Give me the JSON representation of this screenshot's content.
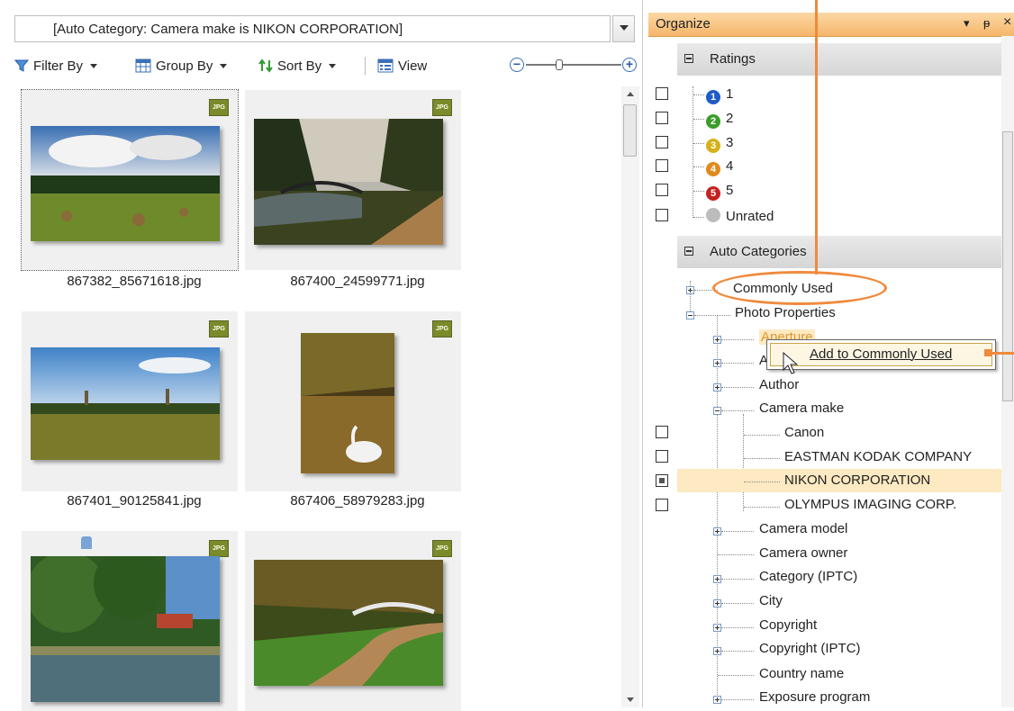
{
  "filter": {
    "text": "[Auto Category: Camera make is NIKON CORPORATION]"
  },
  "toolbar": {
    "filter_label": "Filter By",
    "group_label": "Group By",
    "sort_label": "Sort By",
    "view_label": "View",
    "zoom_minus": "−",
    "zoom_plus": "+",
    "zoom_level": 0
  },
  "thumbnails": [
    {
      "file": "867382_85671618.jpg",
      "badge": "JPG",
      "selected": true
    },
    {
      "file": "867400_24599771.jpg",
      "badge": "JPG"
    },
    {
      "file": "867401_90125841.jpg",
      "badge": "JPG"
    },
    {
      "file": "867406_58979283.jpg",
      "badge": "JPG"
    },
    {
      "file": "",
      "badge": "JPG"
    },
    {
      "file": "",
      "badge": "JPG"
    }
  ],
  "organize": {
    "title": "Organize",
    "controls": {
      "menu": "▾",
      "pin": "ᵽ",
      "close": "×"
    }
  },
  "ratings": {
    "title": "Ratings",
    "items": [
      {
        "label": "1",
        "color": "#1e5bc6"
      },
      {
        "label": "2",
        "color": "#3a9d2a"
      },
      {
        "label": "3",
        "color": "#d6b21a"
      },
      {
        "label": "4",
        "color": "#e08a1e"
      },
      {
        "label": "5",
        "color": "#c4221f"
      },
      {
        "label": "Unrated",
        "color": "#bcbcbc"
      }
    ]
  },
  "auto_categories": {
    "title": "Auto Categories",
    "commonly_used": "Commonly Used",
    "photo_properties": "Photo Properties",
    "aperture": "Aperture",
    "a_item": "A",
    "author": "Author",
    "camera_make": "Camera make",
    "makes": [
      "Canon",
      "EASTMAN KODAK COMPANY",
      "NIKON CORPORATION",
      "OLYMPUS IMAGING CORP."
    ],
    "after": [
      "Camera model",
      "Camera owner",
      "Category (IPTC)",
      "City",
      "Copyright",
      "Copyright (IPTC)",
      "Country name",
      "Exposure program"
    ]
  },
  "context_menu": {
    "label": "Add to Commonly Used"
  },
  "colors": {
    "accent": "#f08a3c",
    "selection": "#fde9c2",
    "header": "#f6b66a"
  }
}
